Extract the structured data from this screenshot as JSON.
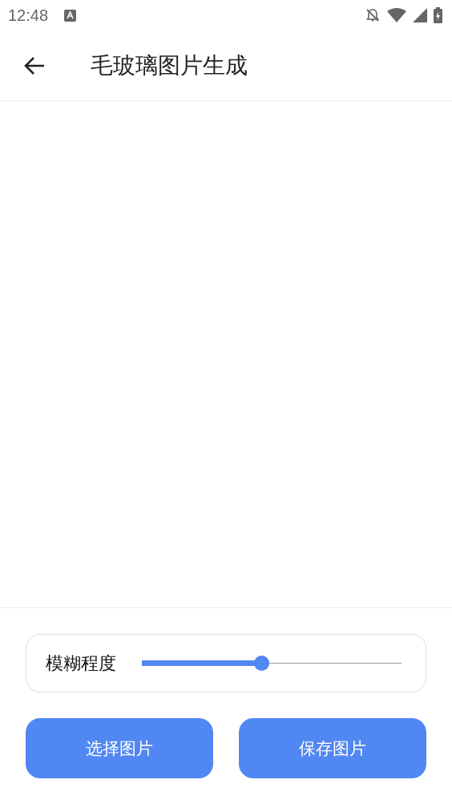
{
  "status_bar": {
    "time": "12:48"
  },
  "app_bar": {
    "title": "毛玻璃图片生成"
  },
  "blur": {
    "label": "模糊程度",
    "level": 0.46
  },
  "buttons": [
    {
      "label": "选择图片"
    },
    {
      "label": "保存图片"
    }
  ]
}
